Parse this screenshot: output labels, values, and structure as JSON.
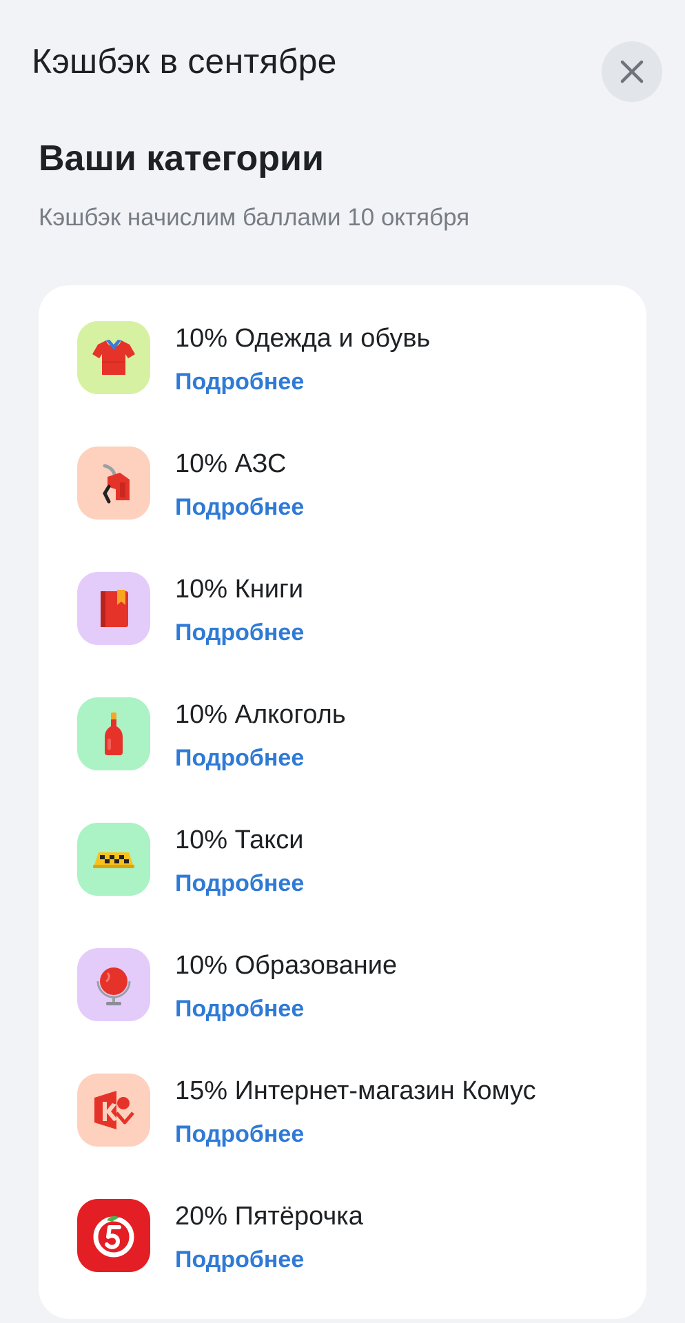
{
  "header": {
    "title": "Кэшбэк в сентябре"
  },
  "section": {
    "title": "Ваши категории",
    "subtitle": "Кэшбэк начислим баллами 10 октября"
  },
  "items": [
    {
      "title": "10% Одежда и обувь",
      "link": "Подробнее",
      "icon": "tshirt-icon",
      "tile_color": "#d7f1a3"
    },
    {
      "title": "10% АЗС",
      "link": "Подробнее",
      "icon": "fuel-nozzle-icon",
      "tile_color": "#fdd1bd"
    },
    {
      "title": "10% Книги",
      "link": "Подробнее",
      "icon": "book-icon",
      "tile_color": "#e4ccfa"
    },
    {
      "title": "10% Алкоголь",
      "link": "Подробнее",
      "icon": "bottle-icon",
      "tile_color": "#abf2c4"
    },
    {
      "title": "10% Такси",
      "link": "Подробнее",
      "icon": "taxi-sign-icon",
      "tile_color": "#abf2c4"
    },
    {
      "title": "10% Образование",
      "link": "Подробнее",
      "icon": "globe-icon",
      "tile_color": "#e4ccfa"
    },
    {
      "title": "15% Интернет-магазин Комус",
      "link": "Подробнее",
      "icon": "komus-logo-icon",
      "tile_color": "#fdd1bd"
    },
    {
      "title": "20% Пятёрочка",
      "link": "Подробнее",
      "icon": "pyaterochka-logo-icon",
      "tile_color": "#e31e24"
    }
  ],
  "colors": {
    "link": "#2f7ad6",
    "background": "#f1f3f6",
    "card": "#ffffff"
  }
}
